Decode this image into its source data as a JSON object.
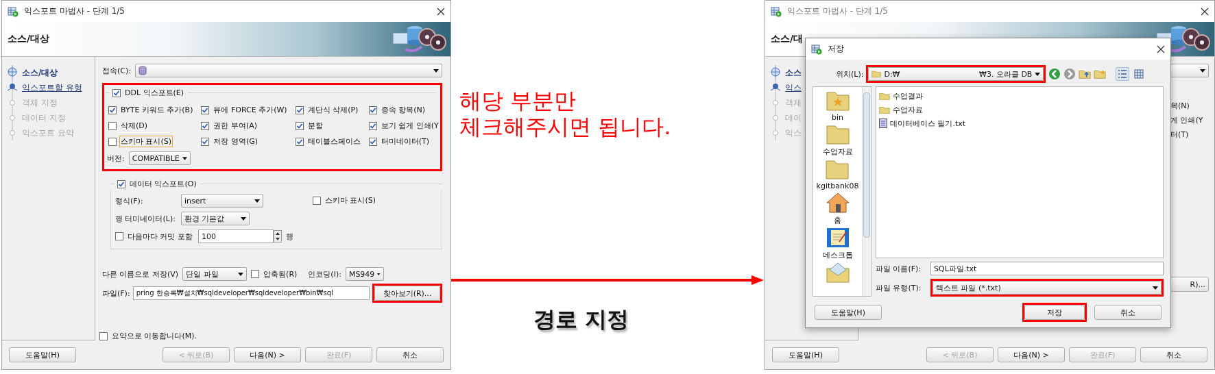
{
  "export_wizard": {
    "title": "익스포트 마법사 - 단계 1/5",
    "header": "소스/대상",
    "steps": [
      {
        "label": "소스/대상",
        "kind": "active"
      },
      {
        "label": "익스포트할 유형",
        "kind": "link"
      },
      {
        "label": "객체 지정",
        "kind": "pending"
      },
      {
        "label": "데이터 지정",
        "kind": "pending"
      },
      {
        "label": "익스포트 요약",
        "kind": "pending"
      }
    ],
    "connection_label": "접속(C):",
    "ddl_export": {
      "label": "DDL 익스포트(E)",
      "checked": true,
      "highlighted": true,
      "options": [
        {
          "label": "BYTE 키워드 추가(B)",
          "checked": true,
          "focused": false
        },
        {
          "label": "뷰에 FORCE 추가(W)",
          "checked": true,
          "focused": false
        },
        {
          "label": "계단식 삭제(P)",
          "checked": true,
          "focused": false
        },
        {
          "label": "종속 항목(N)",
          "checked": true,
          "focused": false
        },
        {
          "label": "삭제(D)",
          "checked": false,
          "focused": false
        },
        {
          "label": "권한 부여(A)",
          "checked": true,
          "focused": false
        },
        {
          "label": "분할",
          "checked": true,
          "focused": false
        },
        {
          "label": "보기 쉽게 인쇄(Y",
          "checked": true,
          "focused": false
        },
        {
          "label": "스키마 표시(S)",
          "checked": false,
          "focused": true
        },
        {
          "label": "저장 영역(G)",
          "checked": true,
          "focused": false
        },
        {
          "label": "테이블스페이스",
          "checked": true,
          "focused": false
        },
        {
          "label": "터미네이터(T)",
          "checked": true,
          "focused": false
        }
      ],
      "version_label": "버전:",
      "version": "COMPATIBLE"
    },
    "data_export": {
      "label": "데이터 익스포트(O)",
      "checked": true,
      "format_label": "형식(F):",
      "format": "insert",
      "show_schema": {
        "label": "스키마 표시(S)",
        "checked": false
      },
      "row_terminator_label": "행 터미네이터(L):",
      "row_terminator": "환경 기본값",
      "commit": {
        "label": "다음마다 커밋 포함",
        "checked": false
      },
      "commit_rows": "100",
      "rows_unit": "행"
    },
    "save_as_label": "다른 이름으로 저장(V)",
    "save_as": "단일 파일",
    "compressed": {
      "label": "압축됨(R)",
      "checked": false
    },
    "encoding_label": "인코딩(I):",
    "encoding": "MS949",
    "file_label": "파일(F):",
    "file": "pring 한승록₩설치₩sqldeveloper₩sqldeveloper₩bin₩sql",
    "browse": {
      "label": "찾아보기(R)...",
      "highlighted": true
    },
    "go_to_summary": {
      "label": "요약으로 이동합니다(M).",
      "checked": false
    },
    "buttons": [
      {
        "label": "도움말(H)",
        "disabled": false
      },
      {
        "label": "< 뒤로(B)",
        "disabled": true
      },
      {
        "label": "다음(N) >",
        "disabled": false
      },
      {
        "label": "완료(F)",
        "disabled": true
      },
      {
        "label": "취소",
        "disabled": false
      }
    ]
  },
  "note": "해당 부분만\n체크해주시면 됩니다.",
  "caption": "경로 지정",
  "background_wizard": {
    "title": "익스포트 마법사 - 단계 1/5",
    "header": "소스/대",
    "steps": [
      {
        "label": "소스",
        "kind": "active"
      },
      {
        "label": "익스",
        "kind": "link"
      },
      {
        "label": "객체",
        "kind": "pending"
      },
      {
        "label": "데이",
        "kind": "pending"
      },
      {
        "label": "익스",
        "kind": "pending"
      }
    ],
    "fragments": [
      "목(N)",
      "게 인쇄(Y",
      "터(T)"
    ],
    "browse_fragment": "R)...",
    "buttons": [
      {
        "label": "도움말(H)",
        "disabled": false
      },
      {
        "label": "< 뒤로(B)",
        "disabled": true
      },
      {
        "label": "다음(N) >",
        "disabled": false
      },
      {
        "label": "완료(F)",
        "disabled": true
      },
      {
        "label": "취소",
        "disabled": false
      }
    ]
  },
  "save_dialog": {
    "title": "저장",
    "location_label": "위치(L):",
    "location": {
      "start": "D:₩",
      "end": "₩3. 오라클 DB",
      "highlighted": true
    },
    "views": [
      {
        "kind": "list",
        "selected": true
      },
      {
        "kind": "details",
        "selected": false
      }
    ],
    "places": [
      {
        "label": "bin",
        "kind": "star"
      },
      {
        "label": "수업자료",
        "kind": "folder"
      },
      {
        "label": "kgitbank08",
        "kind": "folder"
      },
      {
        "label": "홈",
        "kind": "home"
      },
      {
        "label": "데스크톱",
        "kind": "notepad"
      },
      {
        "kind": "envelope"
      }
    ],
    "files": [
      {
        "name": "수업결과",
        "kind": "folder"
      },
      {
        "name": "수업자료",
        "kind": "folder"
      },
      {
        "name": "데이터베이스 필기.txt",
        "kind": "file"
      }
    ],
    "file_name_label": "파일 이름(F):",
    "file_name": "SQL파일.txt",
    "file_type_label": "파일 유형(T):",
    "file_type": {
      "value": "텍스트 파일 (*.txt)",
      "highlighted": true
    },
    "buttons": [
      {
        "label": "도움말(H)",
        "highlighted": false
      },
      {
        "label": "저장",
        "highlighted": true
      },
      {
        "label": "취소",
        "highlighted": false
      }
    ]
  }
}
